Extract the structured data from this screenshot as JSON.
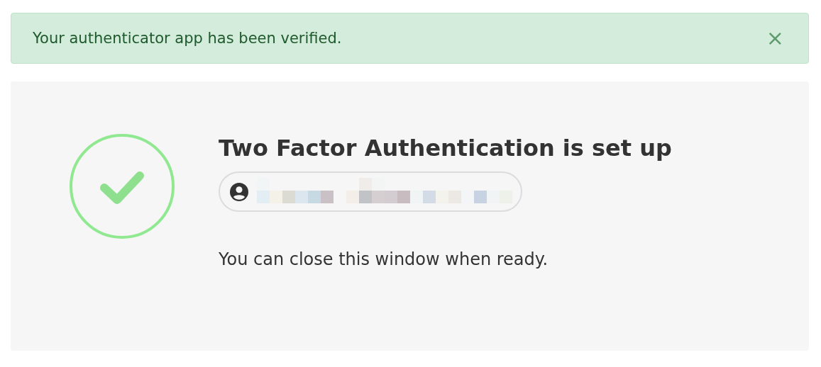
{
  "alert": {
    "message": "Your authenticator app has been verified.",
    "close": "×"
  },
  "status": {
    "kind": "success"
  },
  "title": "Two Factor Authentication is set up",
  "note": "You can close this window when ready."
}
